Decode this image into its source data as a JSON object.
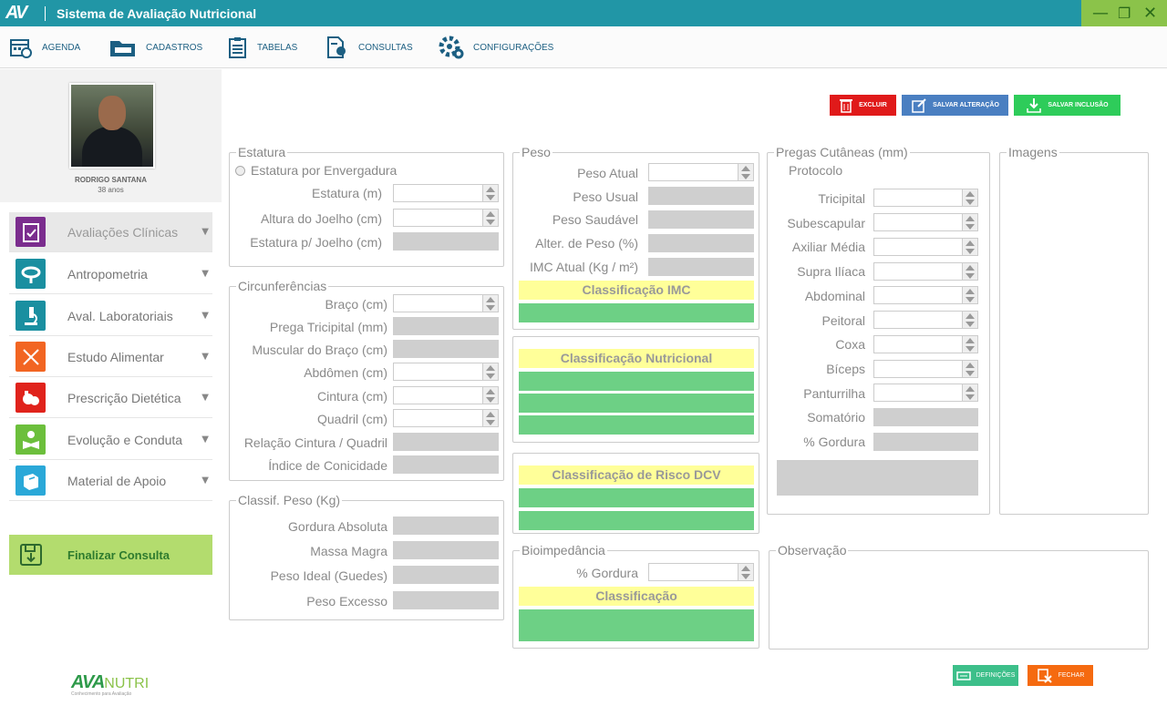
{
  "app": {
    "logo": "AV",
    "title": "Sistema de Avaliação Nutricional"
  },
  "window": {
    "minimize": "—",
    "restore": "❐",
    "close": "✕"
  },
  "menu": [
    {
      "label": "AGENDA",
      "icon": "calendar-icon"
    },
    {
      "label": "CADASTROS",
      "icon": "folder-icon"
    },
    {
      "label": "TABELAS",
      "icon": "clipboard-icon"
    },
    {
      "label": "CONSULTAS",
      "icon": "document-search-icon"
    },
    {
      "label": "CONFIGURAÇÕES",
      "icon": "gears-icon"
    }
  ],
  "patient": {
    "name": "RODRIGO SANTANA",
    "age": "38 anos"
  },
  "nav": [
    {
      "label": "Avaliações Clínicas",
      "icon": "clipboard-check-icon",
      "color": "#7b2d8e"
    },
    {
      "label": "Antropometria",
      "icon": "tape-measure-icon",
      "color": "#1a8fa0"
    },
    {
      "label": "Aval. Laboratoriais",
      "icon": "microscope-icon",
      "color": "#1a8fa0"
    },
    {
      "label": "Estudo Alimentar",
      "icon": "fork-knife-icon",
      "color": "#f26522"
    },
    {
      "label": "Prescrição Dietética",
      "icon": "food-icon",
      "color": "#e0231c"
    },
    {
      "label": "Evolução e Conduta",
      "icon": "person-book-icon",
      "color": "#6cbf3c"
    },
    {
      "label": "Material de Apoio",
      "icon": "book-icon",
      "color": "#2aa8d8"
    }
  ],
  "finalizar": {
    "label": "Finalizar Consulta",
    "icon": "save-icon"
  },
  "brand": {
    "name_a": "AVA",
    "name_b": "NUTRI",
    "tagline": "Conhecimento para Avaliação"
  },
  "actions": {
    "excluir": "EXCLUIR",
    "salvar_alteracao": "SALVAR ALTERAÇÃO",
    "salvar_inclusao": "SALVAR INCLUSÃO"
  },
  "estatura": {
    "legend": "Estatura",
    "radio": "Estatura por Envergadura",
    "estatura_m": "Estatura (m)",
    "altura_joelho": "Altura do Joelho (cm)",
    "estatura_joelho": "Estatura p/ Joelho (cm)"
  },
  "circ": {
    "legend": "Circunferências",
    "braco": "Braço (cm)",
    "prega_tricipital": "Prega Tricipital (mm)",
    "muscular_braco": "Muscular do Braço (cm)",
    "abdomen": "Abdômen (cm)",
    "cintura": "Cintura (cm)",
    "quadril": "Quadril (cm)",
    "relacao": "Relação Cintura / Quadril",
    "conicidade": "Índice de Conicidade"
  },
  "classif_peso": {
    "legend": "Classif. Peso (Kg)",
    "gordura_absoluta": "Gordura Absoluta",
    "massa_magra": "Massa Magra",
    "peso_ideal": "Peso Ideal (Guedes)",
    "peso_excesso": "Peso Excesso"
  },
  "peso": {
    "legend": "Peso",
    "atual": "Peso Atual",
    "usual": "Peso Usual",
    "saudavel": "Peso Saudável",
    "alter": "Alter. de Peso (%)",
    "imc": "IMC Atual (Kg / m²)",
    "class_imc": "Classificação IMC"
  },
  "class_nutricional": "Classificação Nutricional",
  "class_risco": "Classificação de Risco DCV",
  "bio": {
    "legend": "Bioimpedância",
    "gordura": "% Gordura",
    "classificacao": "Classificação"
  },
  "pregas": {
    "legend": "Pregas Cutâneas (mm)",
    "protocolo": "Protocolo",
    "tricipital": "Tricipital",
    "subescapular": "Subescapular",
    "axiliar": "Axiliar Média",
    "supra": "Supra Ilíaca",
    "abdominal": "Abdominal",
    "peitoral": "Peitoral",
    "coxa": "Coxa",
    "biceps": "Bíceps",
    "panturrilha": "Panturrilha",
    "somatorio": "Somatório",
    "gordura": "% Gordura"
  },
  "imagens": {
    "legend": "Imagens"
  },
  "observacao": {
    "legend": "Observação"
  },
  "footer": {
    "definicoes": "DEFINIÇÕES",
    "fechar": "FECHAR"
  }
}
